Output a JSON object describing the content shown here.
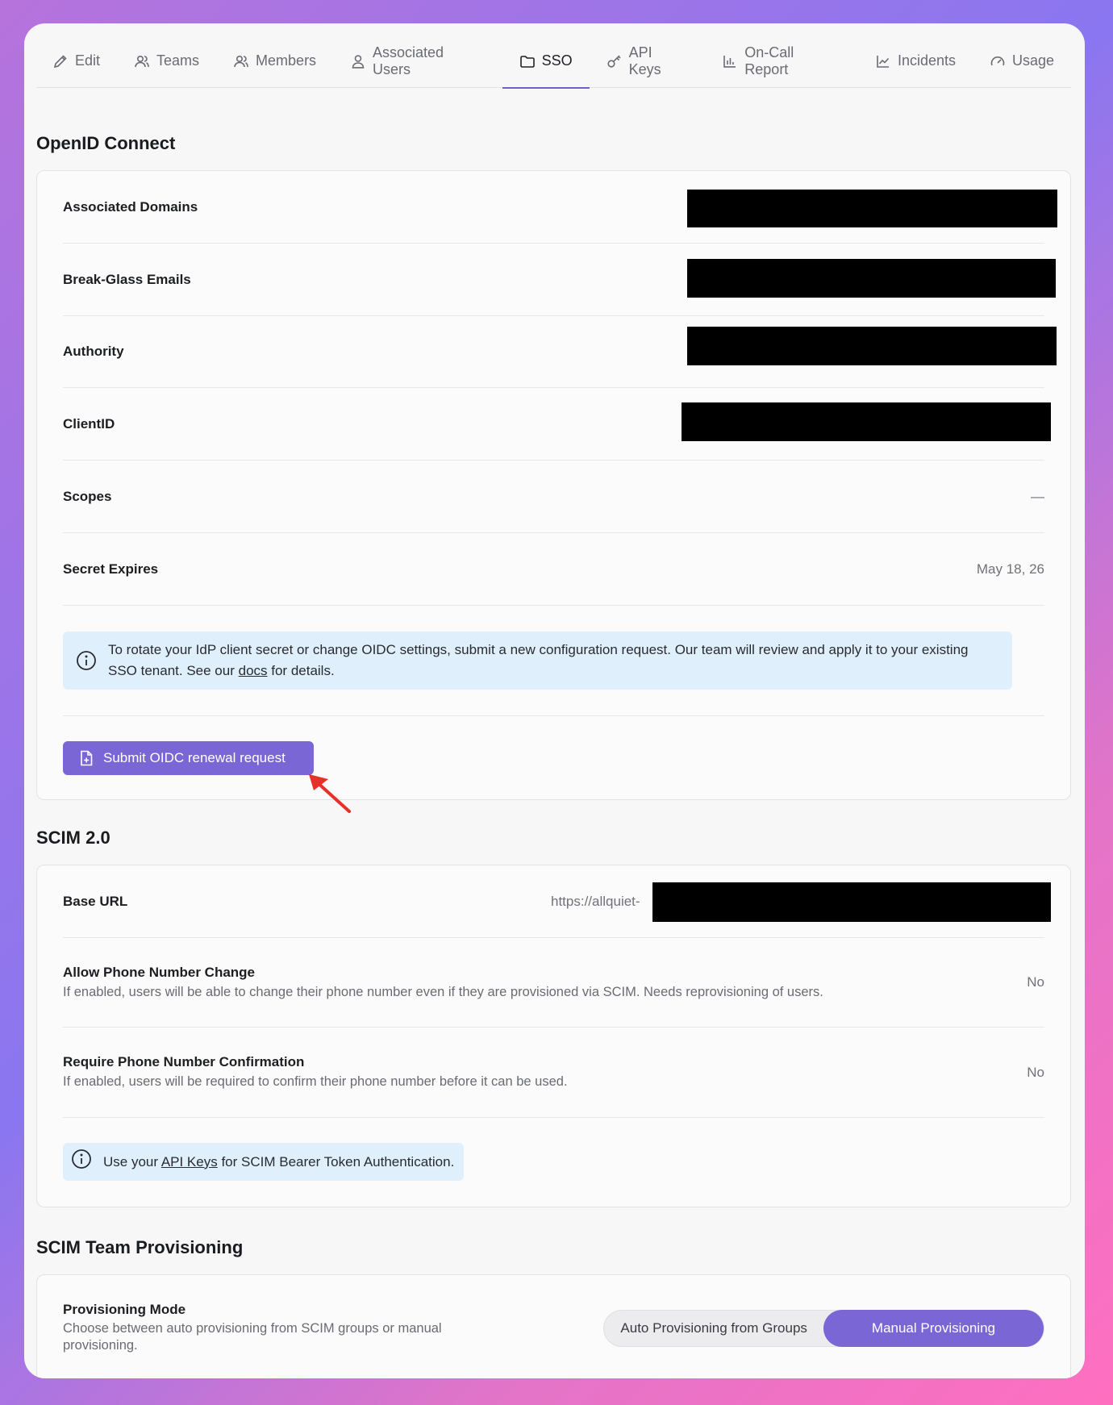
{
  "tabs": [
    {
      "label": "Edit",
      "icon": "pencil-icon"
    },
    {
      "label": "Teams",
      "icon": "teams-icon"
    },
    {
      "label": "Members",
      "icon": "members-icon"
    },
    {
      "label": "Associated Users",
      "icon": "user-icon"
    },
    {
      "label": "SSO",
      "icon": "folder-icon",
      "active": true
    },
    {
      "label": "API Keys",
      "icon": "key-icon"
    },
    {
      "label": "On-Call Report",
      "icon": "bar-chart-icon"
    },
    {
      "label": "Incidents",
      "icon": "line-chart-icon"
    },
    {
      "label": "Usage",
      "icon": "gauge-icon"
    }
  ],
  "oidc": {
    "title": "OpenID Connect",
    "rows": {
      "domains": "Associated Domains",
      "break_glass": "Break-Glass Emails",
      "authority": "Authority",
      "client_id": "ClientID",
      "scopes": "Scopes",
      "scopes_value": "—",
      "secret_expires": "Secret Expires",
      "secret_expires_value": "May 18, 26"
    },
    "info_before": "To rotate your IdP client secret or change OIDC settings, submit a new configuration request. Our team will review and apply it to your existing SSO tenant. See our ",
    "info_link": "docs",
    "info_after": " for details.",
    "button": "Submit OIDC renewal request"
  },
  "scim": {
    "title": "SCIM 2.0",
    "base_url_label": "Base URL",
    "base_url_value": "https://allquiet-",
    "phone_change_label": "Allow Phone Number Change",
    "phone_change_desc": "If enabled, users will be able to change their phone number even if they are provisioned via SCIM. Needs reprovisioning of users.",
    "phone_change_value": "No",
    "phone_confirm_label": "Require Phone Number Confirmation",
    "phone_confirm_desc": "If enabled, users will be required to confirm their phone number before it can be used.",
    "phone_confirm_value": "No",
    "info_before": "Use your ",
    "info_link": "API Keys",
    "info_after": " for SCIM Bearer Token Authentication."
  },
  "team_prov": {
    "title": "SCIM Team Provisioning",
    "mode_label": "Provisioning Mode",
    "mode_desc": "Choose between auto provisioning from SCIM groups or manual provisioning.",
    "options": [
      "Auto Provisioning from Groups",
      "Manual Provisioning"
    ],
    "selected": "Manual Provisioning"
  },
  "colors": {
    "accent": "#7b66d6",
    "info_bg": "#dff0fc",
    "arrow": "#e8302a"
  }
}
